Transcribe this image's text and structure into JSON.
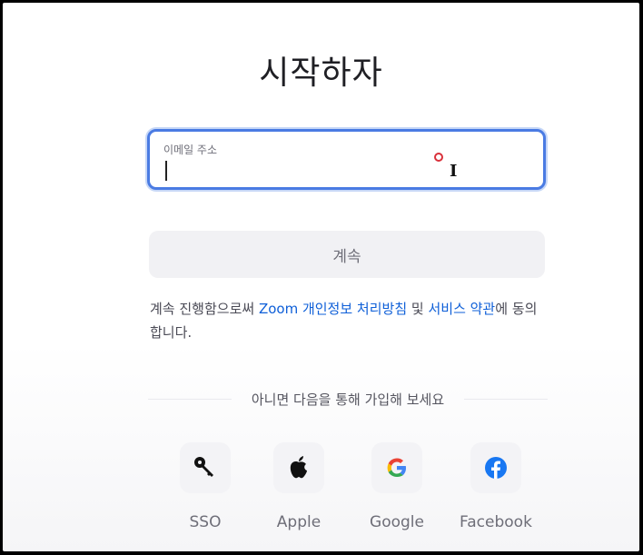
{
  "page": {
    "title": "시작하자"
  },
  "email": {
    "label": "이메일 주소",
    "value": ""
  },
  "continue_button": {
    "label": "계속"
  },
  "legal": {
    "prefix": "계속 진행함으로써 ",
    "privacy_link": "Zoom 개인정보 처리방침",
    "and": " 및 ",
    "terms_link": "서비스 약관",
    "suffix": "에 동의합니다."
  },
  "divider": {
    "text": "아니면 다음을 통해 가입해 보세요"
  },
  "sso_options": [
    {
      "label": "SSO",
      "icon": "key-icon"
    },
    {
      "label": "Apple",
      "icon": "apple-icon"
    },
    {
      "label": "Google",
      "icon": "google-icon"
    },
    {
      "label": "Facebook",
      "icon": "facebook-icon"
    }
  ],
  "colors": {
    "accent": "#4a7be3",
    "link": "#0e5fd8",
    "facebook": "#1877f2",
    "cursor_ring": "#d9303a"
  }
}
